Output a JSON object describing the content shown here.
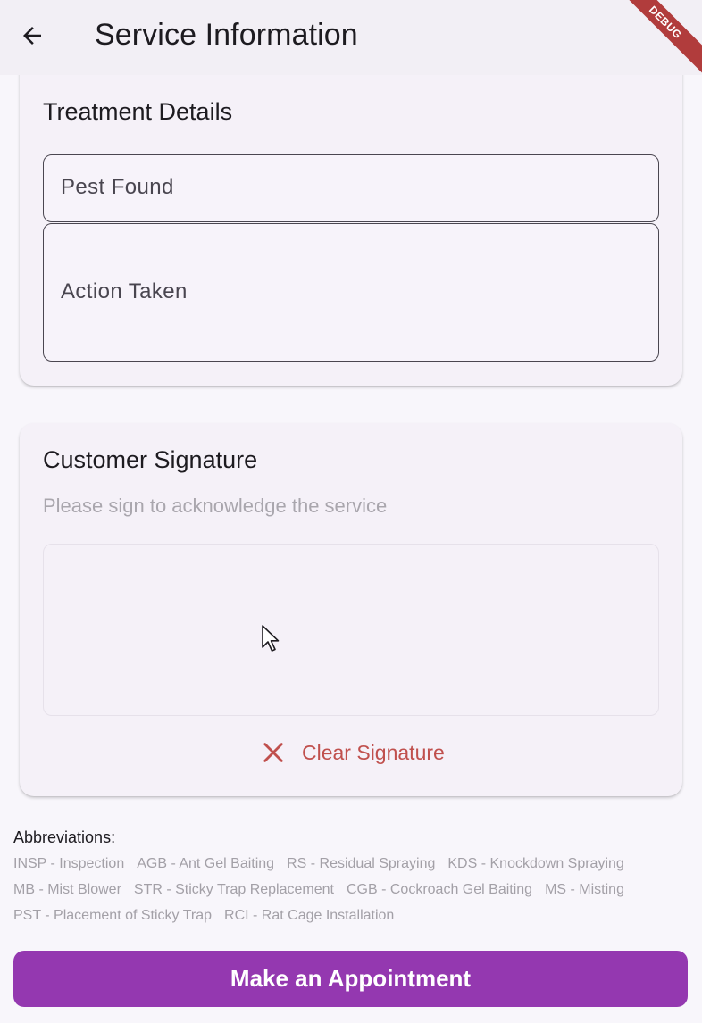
{
  "appbar": {
    "title": "Service Information",
    "back_icon": "arrow-left-icon",
    "debug_label": "DEBUG"
  },
  "treatment": {
    "title": "Treatment Details",
    "pest_found_label": "Pest Found",
    "action_taken_label": "Action Taken"
  },
  "signature": {
    "title": "Customer Signature",
    "subtitle": "Please sign to acknowledge the service",
    "clear_label": "Clear Signature",
    "clear_icon": "close-icon"
  },
  "abbreviations": {
    "heading": "Abbreviations:",
    "items": [
      "INSP - Inspection",
      "AGB - Ant Gel Baiting",
      "RS - Residual Spraying",
      "KDS - Knockdown Spraying",
      "MB - Mist Blower",
      "STR - Sticky Trap Replacement",
      "CGB - Cockroach Gel Baiting",
      "MS - Misting",
      "PST - Placement of Sticky Trap",
      "RCI - Rat Cage Installation"
    ]
  },
  "actions": {
    "appointment_label": "Make an Appointment"
  },
  "colors": {
    "primary": "#9438b0",
    "danger": "#c0504d",
    "debug": "#b13c3c"
  }
}
